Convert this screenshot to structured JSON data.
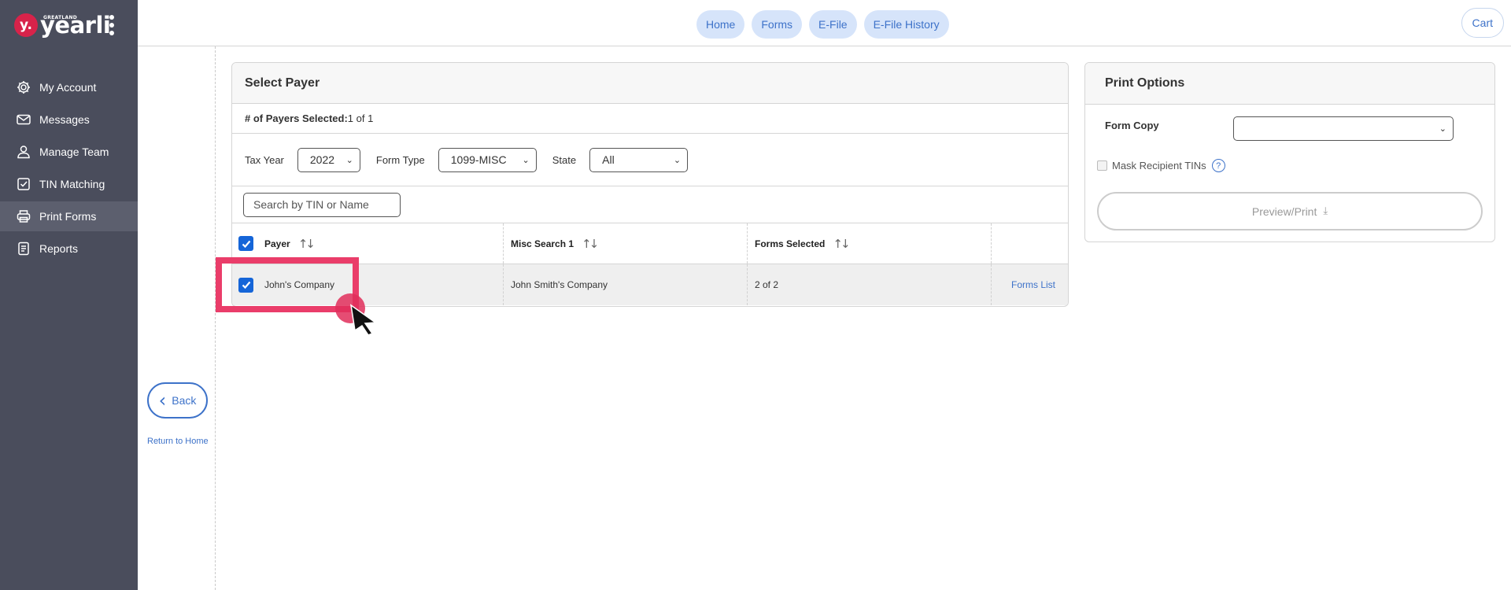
{
  "brand": {
    "small": "GREATLAND",
    "name": "yearli",
    "badge": "y."
  },
  "sidebar": {
    "items": [
      {
        "label": "My Account",
        "icon": "gear-icon"
      },
      {
        "label": "Messages",
        "icon": "envelope-icon"
      },
      {
        "label": "Manage Team",
        "icon": "user-icon"
      },
      {
        "label": "TIN Matching",
        "icon": "checklist-icon"
      },
      {
        "label": "Print Forms",
        "icon": "printer-icon",
        "active": true
      },
      {
        "label": "Reports",
        "icon": "report-icon"
      }
    ]
  },
  "topnav": {
    "tabs": [
      "Home",
      "Forms",
      "E-File",
      "E-File History"
    ],
    "cart": "Cart"
  },
  "left": {
    "back": "Back",
    "return_home": "Return to Home"
  },
  "payer_panel": {
    "title": "Select Payer",
    "count_label": "# of Payers Selected:",
    "count_value": "1 of 1",
    "filters": {
      "tax_year_label": "Tax Year",
      "tax_year_value": "2022",
      "form_type_label": "Form Type",
      "form_type_value": "1099-MISC",
      "state_label": "State",
      "state_value": "All"
    },
    "search_placeholder": "Search by TIN or Name",
    "columns": [
      "Payer",
      "Misc Search 1",
      "Forms Selected"
    ],
    "rows": [
      {
        "payer": "John's Company",
        "misc": "John Smith's Company",
        "forms": "2 of 2",
        "action": "Forms List"
      }
    ]
  },
  "print_panel": {
    "title": "Print Options",
    "form_copy_label": "Form Copy",
    "form_copy_value": "",
    "mask_label": "Mask Recipient TINs",
    "help": "?",
    "preview": "Preview/Print"
  },
  "colors": {
    "sidebar": "#4a4d5c",
    "accent": "#3d72c9",
    "highlight": "#ea3d6a",
    "checkbox": "#1565d8"
  }
}
